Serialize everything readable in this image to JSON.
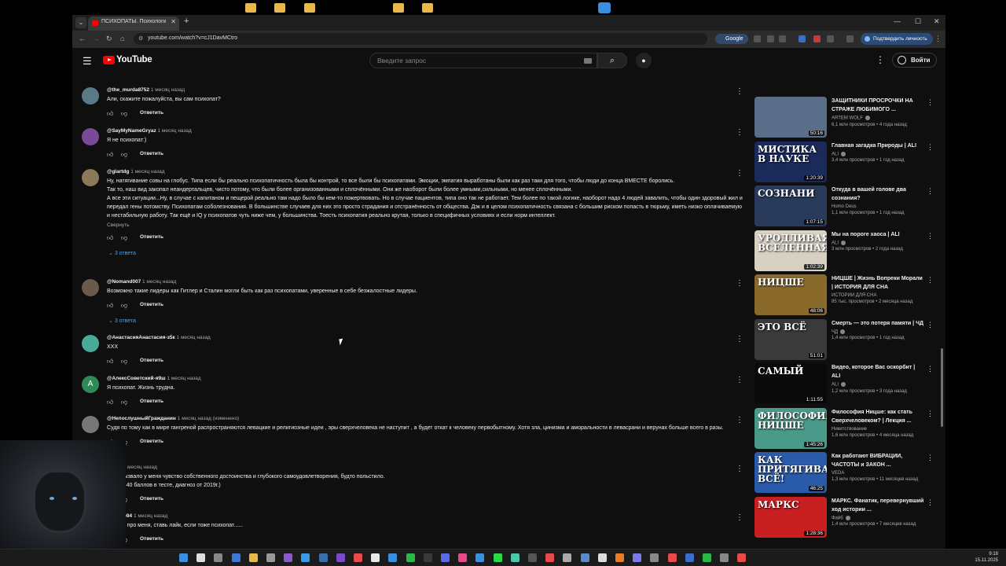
{
  "browser": {
    "tab_title": "ПСИХОПАТЫ. Психология усп",
    "url": "youtube.com/watch?v=cJ1DavMCtro",
    "google_label": "Google",
    "verify_label": "Подтвердить личность"
  },
  "header": {
    "logo": "YouTube",
    "search_placeholder": "Введите запрос",
    "signin_label": "Войти"
  },
  "comments": [
    {
      "author": "@the_murda8752",
      "time": "1 месяц назад",
      "text": "Али, скажите пожалуйста, вы сам психопат?",
      "reply_label": "Ответить",
      "avatar_color": "#5a7a8a"
    },
    {
      "author": "@SayMyNameGryaz",
      "time": "1 месяц назад",
      "text": "Я не психопат:)",
      "reply_label": "Ответить",
      "avatar_color": "#7a4a9a"
    },
    {
      "author": "@glartdg",
      "time": "1 месяц назад",
      "text": "Ну, натягивание совы на глобус. Типа если бы реально психопатичность была бы контрой, то все были бы психопатами. Эмоции, эмпатия выработаны были как раз таки для того, чтобы люди до конца ВМЕСТЕ боролись.\nТак то, наш вид закопал неандертальцев, чисто потому, что были более организованными и сплочёнными. Они же наоборот были более умными,сильными, но менее сплочёнными.\n А все эти ситуации...Ну, в случае с капитаном и пещерой  реально там надо было бы кем-то пожертвовать. Но в случае пациентов, типа оно так не работает. Тем более по такой логике, наоборот надо 4 людей завалить, чтобы один здоровый жил и передал гены потомству. Психопатам соболезнования. В большинстве случаев для них это просто страдания и отстранённость от общества. Дэк и в целом психопатичность связана с большим риском попасть в тюрьму, иметь низко оплачиваемую и нестабильную работу. Так ещё и IQ у психопатов чуть ниже чем, у большинства. Тоесть психопатия реально крутая, только в специфичных условиях и если норм интеллект.",
      "collapse_label": "Свернуть",
      "reply_label": "Ответить",
      "replies_label": "3 ответа",
      "avatar_color": "#8a7a5a"
    },
    {
      "author": "@Nomand007",
      "time": "1 месяц назад",
      "text": "Возможно такие лидеры как Гитлер и Сталин могли быть как раз психопатами, уверенные в себе безжалостные лидеры.",
      "reply_label": "Ответить",
      "replies_label": "3 ответа",
      "avatar_color": "#6a5a4a"
    },
    {
      "author": "@АнастасияАнастасия-з5к",
      "time": "1 месяц назад",
      "text": "ХХХ",
      "reply_label": "Ответить",
      "avatar_color": "#4aaa9a"
    },
    {
      "author": "@АлексСоветский-я9ш",
      "time": "1 месяц назад",
      "text": "Я психопат. Жизнь трудна.",
      "reply_label": "Ответить",
      "avatar_letter": "А",
      "avatar_color": "#2e8b57"
    },
    {
      "author": "@НепослушныйГражданин",
      "time": "1 месяц назад (изменено)",
      "text": "Судя по тому как в мире гангреной распространяются левацкие и религиозные идеи , эры сверхчеловека не наступит , а будет откат к человеку первобытному. Хотя зла, цинизма и аморальности в левасрани и верунах больше всего в разы.",
      "reply_label": "Ответить",
      "avatar_color": "#777"
    },
    {
      "author": "-t5121",
      "time": "1 месяц назад",
      "text": "идео вызвало у меня чувство собственного достоинства и глубокого самоудовлетворения, будто польстило.\nо 37 из 40 баллов в тесте, диагноз от 2019г.)",
      "reply_label": "Ответить",
      "avatar_color": "#555"
    },
    {
      "author": "hNurmo94",
      "time": "1 месяц назад",
      "text": "......Это про меня, ставь лайк, если тоже психопат......",
      "reply_label": "Ответить",
      "avatar_color": "#555"
    }
  ],
  "sidebar": [
    {
      "title": "ЗАЩИТНИКИ ПРОСРОЧКИ НА СТРАЖЕ ЛЮБИМОГО ...",
      "channel": "ARTEM WOLF",
      "verified": true,
      "views": "6,1 млн просмотров",
      "age": "4 года назад",
      "duration": "50:16",
      "thumb_text": "",
      "thumb_color": "#5a6e8a"
    },
    {
      "title": "Главная загадка Природы | ALI",
      "channel": "ALI",
      "verified": true,
      "views": "3,4 млн просмотров",
      "age": "1 год назад",
      "duration": "1:20:39",
      "thumb_text": "МИСТИКА В НАУКЕ",
      "thumb_color": "#1a2a5a"
    },
    {
      "title": "Откуда в вашей голове два сознания?",
      "channel": "Homo Deus",
      "verified": false,
      "views": "1,1 млн просмотров",
      "age": "1 год назад",
      "duration": "1:07:15",
      "thumb_text": "СОЗНАНИ",
      "thumb_color": "#2a3a5a"
    },
    {
      "title": "Мы на пороге хаоса | ALI",
      "channel": "ALI",
      "verified": true,
      "views": "3 млн просмотров",
      "age": "2 года назад",
      "duration": "1:02:39",
      "thumb_text": "УРОДЛИВАЯ ВСЕЛЕННАЯ",
      "thumb_color": "#d8d0c0"
    },
    {
      "title": "НИЦШЕ | Жизнь Вопреки Морали | ИСТОРИЯ ДЛЯ СНА",
      "channel": "ИСТОРИИ ДЛЯ СНА",
      "verified": false,
      "views": "85 тыс. просмотров",
      "age": "2 месяца назад",
      "duration": "48:06",
      "thumb_text": "НИЦШЕ",
      "thumb_color": "#8a6a2a"
    },
    {
      "title": "Смерть — это потеря памяти | ЧД",
      "channel": "ЧД",
      "verified": true,
      "views": "1,4 млн просмотров",
      "age": "1 год назад",
      "duration": "51:01",
      "thumb_text": "ЭТО ВСЁ",
      "thumb_color": "#3a3a3a"
    },
    {
      "title": "Видео, которое Вас оскорбит | ALI",
      "channel": "ALI",
      "verified": true,
      "views": "1,2 млн просмотров",
      "age": "3 года назад",
      "duration": "1:11:55",
      "thumb_text": "САМЫЙ",
      "thumb_color": "#0a0a0a"
    },
    {
      "title": "Философия Ницше: как стать Сверхчеловеком? | Лекция ...",
      "channel": "Никитствование",
      "verified": false,
      "views": "1,6 млн просмотров",
      "age": "4 месяца назад",
      "duration": "1:45:26",
      "thumb_text": "ФИЛОСОФИЯ НИЦШЕ",
      "thumb_color": "#4a9a8a"
    },
    {
      "title": "Как работают ВИБРАЦИИ, ЧАСТОТЫ и ЗАКОН ...",
      "channel": "VEDA",
      "verified": false,
      "views": "1,3 млн просмотров",
      "age": "11 месяцев назад",
      "duration": "46:25",
      "thumb_text": "КАК ПРИТЯГИВАТЬ ВСЁ!",
      "thumb_color": "#2a5aaa"
    },
    {
      "title": "МАРКС. Фанатик, перевернувший ход истории ...",
      "channel": "Файб",
      "verified": true,
      "views": "1,4 млн просмотров",
      "age": "7 месяцев назад",
      "duration": "1:28:36",
      "thumb_text": "МАРКС",
      "thumb_color": "#c82020"
    }
  ],
  "taskbar": {
    "time": "9:18",
    "date": "15.11.2025"
  }
}
